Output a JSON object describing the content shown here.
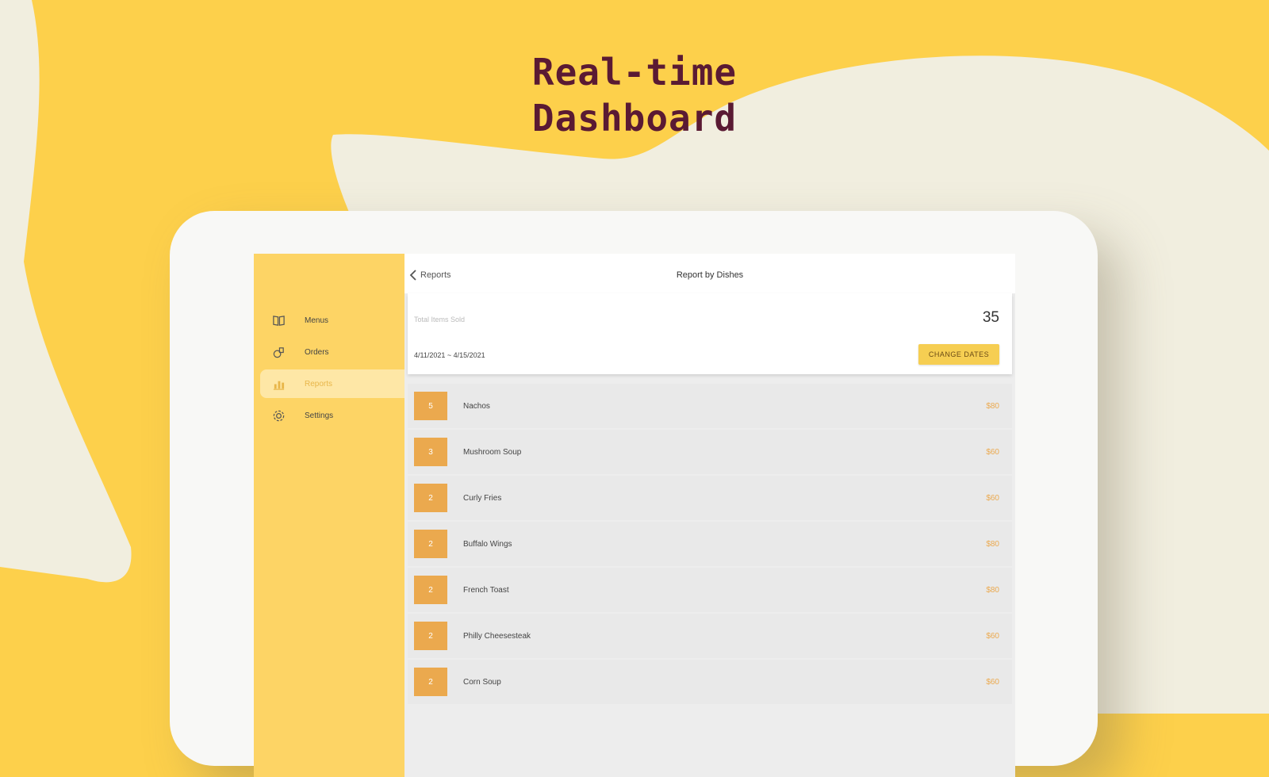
{
  "headline": {
    "line1": "Real-time",
    "line2": "Dashboard"
  },
  "colors": {
    "background": "#FDD04B",
    "cream": "#F1EEDF",
    "headline": "#5A1A33",
    "sidebar": "#FDD465",
    "accent": "#EBA94E",
    "button": "#F6CE52"
  },
  "sidebar": {
    "items": [
      {
        "label": "Menus",
        "icon": "book-icon"
      },
      {
        "label": "Orders",
        "icon": "orders-icon"
      },
      {
        "label": "Reports",
        "icon": "bar-chart-icon",
        "active": true
      },
      {
        "label": "Settings",
        "icon": "gear-icon"
      }
    ]
  },
  "header": {
    "back_label": "Reports",
    "title": "Report by Dishes"
  },
  "summary": {
    "label": "Total Items Sold",
    "value": "35",
    "date_range": "4/11/2021 ~ 4/15/2021",
    "change_dates_label": "CHANGE DATES"
  },
  "dishes": [
    {
      "rank": "5",
      "name": "Nachos",
      "count": "$80"
    },
    {
      "rank": "3",
      "name": "Mushroom Soup",
      "count": "$60"
    },
    {
      "rank": "2",
      "name": "Curly Fries",
      "count": "$60"
    },
    {
      "rank": "2",
      "name": "Buffalo Wings",
      "count": "$80"
    },
    {
      "rank": "2",
      "name": "French Toast",
      "count": "$80"
    },
    {
      "rank": "2",
      "name": "Philly Cheesesteak",
      "count": "$60"
    },
    {
      "rank": "2",
      "name": "Corn Soup",
      "count": "$60"
    }
  ]
}
